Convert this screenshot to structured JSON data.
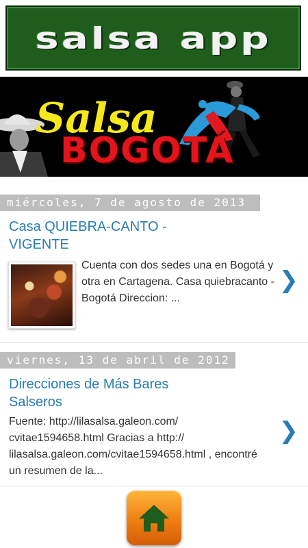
{
  "app": {
    "logo_text": "salsa app"
  },
  "banner": {
    "title_top": "Salsa",
    "title_bottom": "BOGOTÁ"
  },
  "posts": [
    {
      "date": "miércoles, 7 de agosto de 2013",
      "title": "Casa QUIEBRA-CANTO - VIGENTE",
      "summary": "Cuenta con dos sedes una en Bogotá y otra en Cartagena. Casa quiebracanto - Bogotá Direccion: ...",
      "has_thumbnail": true,
      "open_icon": "chevron-right-icon"
    },
    {
      "date": "viernes, 13 de abril de 2012",
      "title": "Direcciones de Más Bares Salseros",
      "summary": "Fuente: http://lilasalsa.galeon.com/ cvitae1594658.html Gracias a http:// lilasalsa.galeon.com/cvitae1594658.html , encontré un resumen de la...",
      "has_thumbnail": false,
      "open_icon": "chevron-right-icon"
    }
  ],
  "footer": {
    "home_icon": "home-icon"
  },
  "colors": {
    "link": "#2a7db4",
    "date_bar": "#bdbdbd",
    "logo_bg": "#1f5d1d",
    "home_button": "#f07e12"
  }
}
